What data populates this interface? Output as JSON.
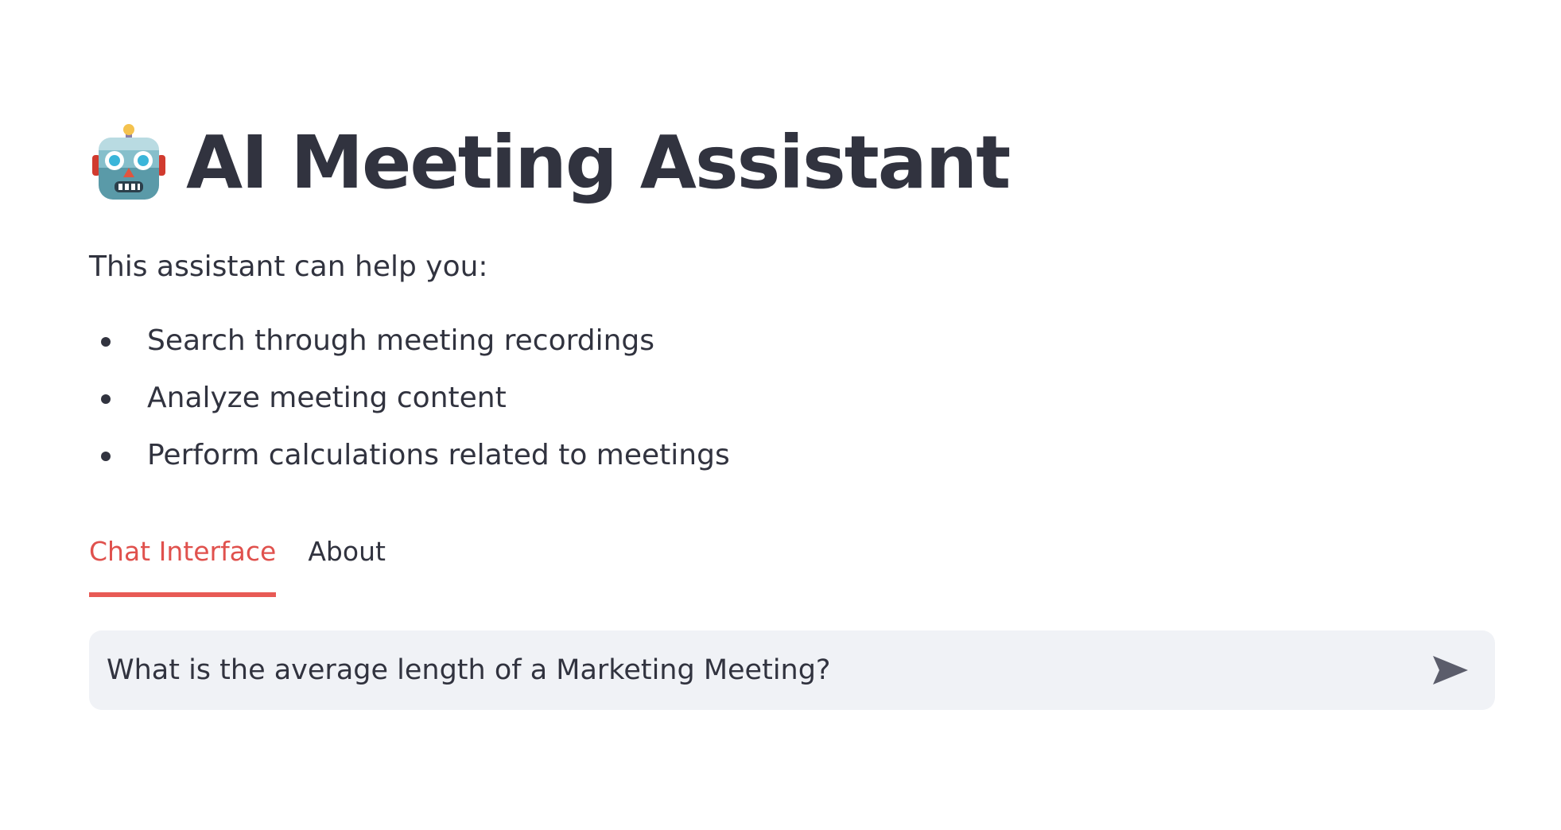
{
  "header": {
    "title": "AI Meeting Assistant",
    "icon": "robot-face-icon"
  },
  "intro": {
    "text": "This assistant can help you:"
  },
  "features": [
    "Search through meeting recordings",
    "Analyze meeting content",
    "Perform calculations related to meetings"
  ],
  "tabs": [
    {
      "label": "Chat Interface",
      "active": true
    },
    {
      "label": "About",
      "active": false
    }
  ],
  "chat": {
    "input_value": "What is the average length of a Marketing Meeting?",
    "send_icon": "send-icon"
  },
  "colors": {
    "accent": "#e0514d",
    "text": "#31333f",
    "input_bg": "#f0f2f6",
    "tab_border": "#ececec"
  }
}
